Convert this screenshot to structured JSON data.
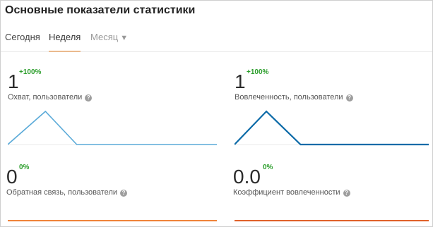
{
  "header": {
    "title": "Основные показатели статистики"
  },
  "tabs": [
    {
      "label": "Сегодня",
      "active": false
    },
    {
      "label": "Неделя",
      "active": true
    },
    {
      "label": "Месяц",
      "active": false
    }
  ],
  "icons": {
    "help": "?",
    "dropdown": "▼"
  },
  "colors": {
    "accent": "#f0821e",
    "delta_positive": "#2a9d2a",
    "reach_line": "#5aaad8",
    "engagement_line": "#0d6ba8",
    "feedback_line": "#f0833a",
    "engagement_rate_line": "#e0622a"
  },
  "metrics": {
    "reach": {
      "value": "1",
      "delta": "+100%",
      "label": "Охват, пользователи",
      "sparkline": [
        0,
        1,
        0,
        0
      ]
    },
    "engagement": {
      "value": "1",
      "delta": "+100%",
      "label": "Вовлеченность, пользователи",
      "sparkline": [
        0,
        1,
        0,
        0
      ]
    },
    "feedback": {
      "value": "0",
      "delta": "0%",
      "label": "Обратная связь, пользователи",
      "sparkline": [
        0,
        0,
        0,
        0
      ]
    },
    "engagement_rate": {
      "value": "0.0",
      "delta": "0%",
      "label": "Коэффициент вовлеченности",
      "sparkline": [
        0,
        0,
        0,
        0
      ]
    }
  }
}
